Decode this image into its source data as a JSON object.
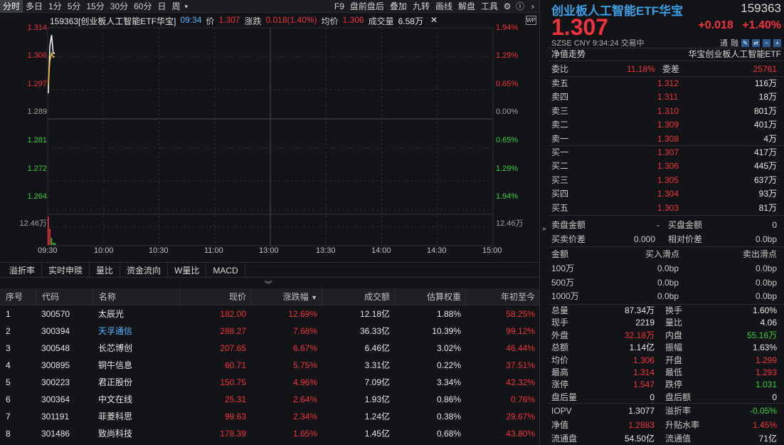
{
  "toolbar": {
    "periods": [
      "分时",
      "多日",
      "1分",
      "5分",
      "15分",
      "30分",
      "60分",
      "日",
      "周"
    ],
    "period_more": "▾",
    "tools": [
      "F9",
      "盘前盘后",
      "叠加",
      "九转",
      "画线",
      "解盘",
      "工具"
    ],
    "active": "分时"
  },
  "chart": {
    "header": {
      "name": "159363[创业板人工智能ETF华宝]",
      "time": "09:34",
      "price_label": "价",
      "price": "1.307",
      "change_label": "涨跌",
      "change": "0.018(1.40%)",
      "avg_label": "均价",
      "avg": "1.306",
      "volume_label": "成交量",
      "volume": "6.58万"
    },
    "price_ticks": [
      "1.314",
      "1.306",
      "1.297",
      "1.289",
      "1.281",
      "1.272",
      "1.264"
    ],
    "pct_ticks": [
      "1.94%",
      "1.29%",
      "0.65%",
      "0.00%",
      "0.65%",
      "1.29%",
      "1.94%"
    ],
    "vol_tick": "12.46万",
    "time_ticks": [
      "09:30",
      "10:00",
      "10:30",
      "11:00",
      "13:00",
      "13:30",
      "14:00",
      "14:30",
      "15:00"
    ]
  },
  "chart_data": {
    "type": "line",
    "title": "159363[创业板人工智能ETF华宝]",
    "xlabel": "",
    "ylabel": "",
    "ylim": [
      1.264,
      1.314
    ],
    "x": [
      "09:30",
      "09:31",
      "09:32",
      "09:33",
      "09:34"
    ],
    "series": [
      {
        "name": "价",
        "values": [
          1.296,
          1.309,
          1.312,
          1.307,
          1.307
        ]
      },
      {
        "name": "均价",
        "values": [
          1.298,
          1.305,
          1.307,
          1.306,
          1.306
        ]
      }
    ],
    "volume_max": "12.46万",
    "volume": [
      0.97,
      0.55,
      0.24,
      0.07,
      0.07
    ]
  },
  "indicators": [
    "溢折率",
    "实时申赎",
    "量比",
    "资金流向",
    "W量比",
    "MACD"
  ],
  "table": {
    "headers": [
      "序号",
      "代码",
      "名称",
      "现价",
      "涨跌幅",
      "成交额",
      "估算权重",
      "年初至今"
    ],
    "sort_marker": "▼",
    "rows": [
      [
        "1",
        "300570",
        "太辰光",
        "182.00",
        "12.69%",
        "12.18亿",
        "1.88%",
        "58.25%"
      ],
      [
        "2",
        "300394",
        "天孚通信",
        "288.27",
        "7.68%",
        "36.33亿",
        "10.39%",
        "99.12%"
      ],
      [
        "3",
        "300548",
        "长芯博创",
        "207.65",
        "6.67%",
        "6.46亿",
        "3.02%",
        "46.44%"
      ],
      [
        "4",
        "300895",
        "铜牛信息",
        "60.71",
        "5.75%",
        "3.31亿",
        "0.22%",
        "37.51%"
      ],
      [
        "5",
        "300223",
        "君正股份",
        "150.75",
        "4.96%",
        "7.09亿",
        "3.34%",
        "42.32%"
      ],
      [
        "6",
        "300364",
        "中文在线",
        "25.31",
        "2.64%",
        "1.93亿",
        "0.86%",
        "0.76%"
      ],
      [
        "7",
        "301191",
        "菲菱科思",
        "99.63",
        "2.34%",
        "1.24亿",
        "0.38%",
        "29.67%"
      ],
      [
        "8",
        "301486",
        "致尚科技",
        "178.39",
        "1.65%",
        "1.45亿",
        "0.68%",
        "43.80%"
      ]
    ]
  },
  "panel": {
    "title": "创业板人工智能ETF华宝",
    "code": "159363",
    "price": "1.307",
    "change": "+0.018",
    "change_pct": "+1.40%",
    "meta": "SZSE  CNY  9:34:24  交易中",
    "flag_tong": "通",
    "flag_rong": "融",
    "nav_label": "净值走势",
    "nav_name": "华宝创业板人工智能ETF",
    "weibi_label": "委比",
    "weibi": "11.18%",
    "weicha_label": "委差",
    "weicha": "25761",
    "asks": [
      {
        "label": "卖五",
        "price": "1.312",
        "vol": "116万"
      },
      {
        "label": "卖四",
        "price": "1.311",
        "vol": "18万"
      },
      {
        "label": "卖三",
        "price": "1.310",
        "vol": "801万"
      },
      {
        "label": "卖二",
        "price": "1.309",
        "vol": "401万"
      },
      {
        "label": "卖一",
        "price": "1.308",
        "vol": "4万"
      }
    ],
    "bids": [
      {
        "label": "买一",
        "price": "1.307",
        "vol": "417万"
      },
      {
        "label": "买二",
        "price": "1.306",
        "vol": "445万"
      },
      {
        "label": "买三",
        "price": "1.305",
        "vol": "637万"
      },
      {
        "label": "买四",
        "price": "1.304",
        "vol": "93万"
      },
      {
        "label": "买五",
        "price": "1.303",
        "vol": "81万"
      }
    ],
    "amt": {
      "sell_amt_label": "卖盘金额",
      "sell_amt": "-",
      "buy_amt_label2": "买盘金额",
      "buy_amt2": "0",
      "buy_spread_label": "买卖价差",
      "buy_spread": "0.000",
      "rel_spread_label": "相对价差",
      "rel_spread": "0.0bp",
      "col1": "金额",
      "col2": "买入滑点",
      "col3": "卖出滑点",
      "slip": [
        {
          "amt": "100万",
          "buy": "0.0bp",
          "sell": "0.0bp"
        },
        {
          "amt": "500万",
          "buy": "0.0bp",
          "sell": "0.0bp"
        },
        {
          "amt": "1000万",
          "buy": "0.0bp",
          "sell": "0.0bp"
        }
      ]
    },
    "stats": [
      {
        "l1": "总量",
        "v1": "87.34万",
        "c1": "white",
        "l2": "换手",
        "v2": "1.60%",
        "c2": "white"
      },
      {
        "l1": "现手",
        "v1": "2219",
        "c1": "white",
        "l2": "量比",
        "v2": "4.06",
        "c2": "white"
      },
      {
        "l1": "外盘",
        "v1": "32.18万",
        "c1": "red",
        "l2": "内盘",
        "v2": "55.16万",
        "c2": "green"
      },
      {
        "l1": "总额",
        "v1": "1.14亿",
        "c1": "white",
        "l2": "振幅",
        "v2": "1.63%",
        "c2": "white"
      },
      {
        "l1": "均价",
        "v1": "1.306",
        "c1": "red",
        "l2": "开盘",
        "v2": "1.299",
        "c2": "red"
      },
      {
        "l1": "最高",
        "v1": "1.314",
        "c1": "red",
        "l2": "最低",
        "v2": "1.293",
        "c2": "red"
      },
      {
        "l1": "涨停",
        "v1": "1.547",
        "c1": "red",
        "l2": "跌停",
        "v2": "1.031",
        "c2": "green"
      },
      {
        "l1": "盘后量",
        "v1": "0",
        "c1": "white",
        "l2": "盘后额",
        "v2": "0",
        "c2": "white"
      }
    ],
    "iopv": [
      {
        "l1": "IOPV",
        "v1": "1.3077",
        "c1": "white",
        "l2": "溢折率",
        "v2": "-0.05%",
        "c2": "green"
      },
      {
        "l1": "净值",
        "v1": "1.2883",
        "c1": "red",
        "l2": "升贴水率",
        "v2": "1.45%",
        "c2": "red"
      },
      {
        "l1": "流通盘",
        "v1": "54.50亿",
        "c1": "white",
        "l2": "流通值",
        "v2": "71亿",
        "c2": "white"
      }
    ]
  },
  "colors": {
    "up": "#f0323c",
    "down": "#35d03c",
    "flat": "#c8c8c8",
    "bg": "#131417",
    "grid": "#2e3036",
    "accent": "#3aa0e6"
  }
}
